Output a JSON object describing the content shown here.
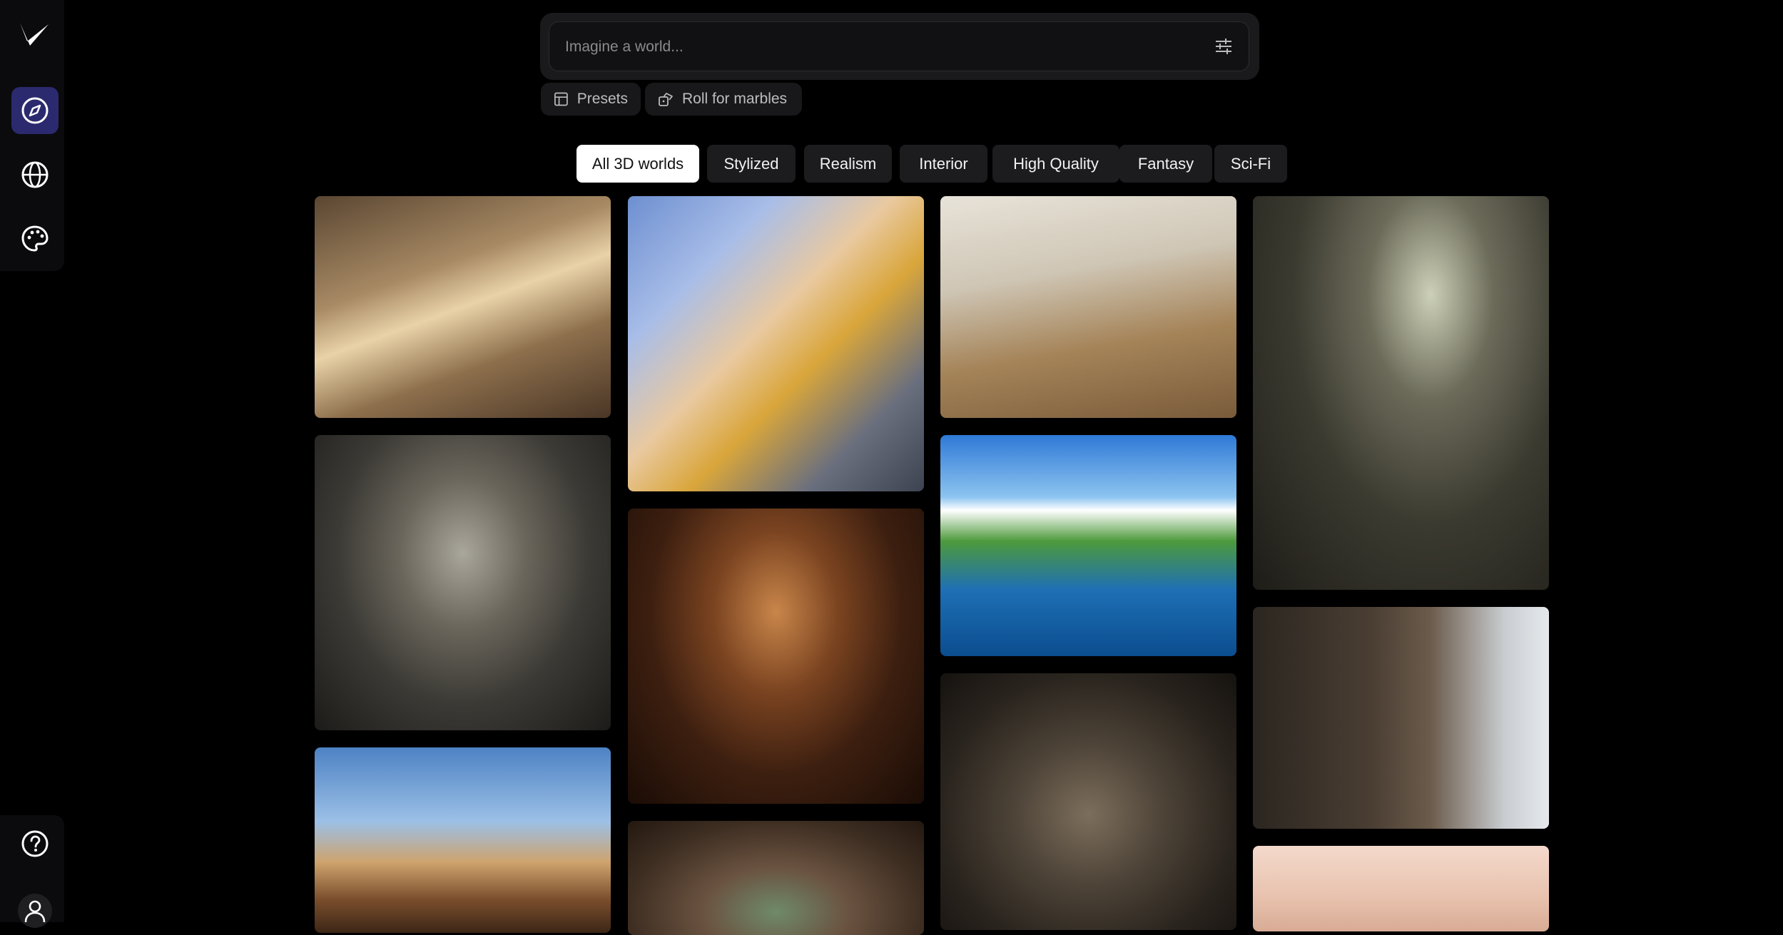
{
  "search": {
    "placeholder": "Imagine a world..."
  },
  "actions": {
    "presets_label": "Presets",
    "roll_label": "Roll for marbles"
  },
  "tabs": [
    {
      "label": "All 3D worlds",
      "active": true
    },
    {
      "label": "Stylized"
    },
    {
      "label": "Realism"
    },
    {
      "label": "Interior"
    },
    {
      "label": "High Quality"
    },
    {
      "label": "Fantasy"
    },
    {
      "label": "Sci-Fi"
    }
  ],
  "sidebar": {
    "items": [
      {
        "icon": "compass-icon",
        "active": true
      },
      {
        "icon": "globe-icon"
      },
      {
        "icon": "palette-icon"
      }
    ],
    "bottom": [
      {
        "icon": "help-icon"
      },
      {
        "icon": "user-icon"
      }
    ]
  },
  "colors": {
    "accent": "#2c2a6e",
    "background": "#000000"
  },
  "gallery": [
    {
      "name": "desert-alley-world"
    },
    {
      "name": "lisbon-tram-street-world"
    },
    {
      "name": "bedroom-interior-world"
    },
    {
      "name": "detective-office-world"
    },
    {
      "name": "spaceship-cockpit-world"
    },
    {
      "name": "tavern-bar-world"
    },
    {
      "name": "cartoon-island-world"
    },
    {
      "name": "log-cabin-world"
    },
    {
      "name": "western-town-world"
    },
    {
      "name": "cave-city-world"
    },
    {
      "name": "cathedral-interior-world"
    },
    {
      "name": "chandelier-room-world"
    }
  ]
}
